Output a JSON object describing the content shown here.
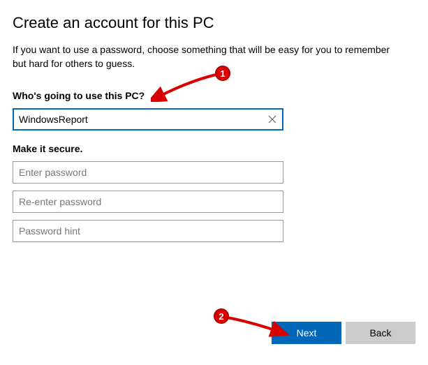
{
  "title": "Create an account for this PC",
  "description": "If you want to use a password, choose something that will be easy for you to remember but hard for others to guess.",
  "section_user": {
    "label": "Who's going to use this PC?",
    "value": "WindowsReport"
  },
  "section_secure": {
    "label": "Make it secure.",
    "password_placeholder": "Enter password",
    "reenter_placeholder": "Re-enter password",
    "hint_placeholder": "Password hint"
  },
  "buttons": {
    "next": "Next",
    "back": "Back"
  },
  "annotations": {
    "badge1": "1",
    "badge2": "2"
  }
}
